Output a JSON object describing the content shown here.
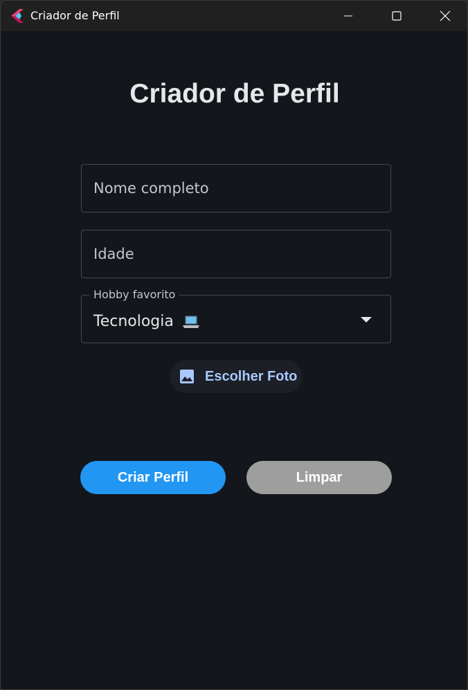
{
  "window": {
    "title": "Criador de Perfil",
    "icon": "flutter-logo-icon"
  },
  "titlebar_buttons": [
    "minimize-icon",
    "maximize-icon",
    "close-icon"
  ],
  "form": {
    "heading": "Criador de Perfil",
    "nome": {
      "placeholder": "Nome completo",
      "value": ""
    },
    "idade": {
      "placeholder": "Idade",
      "value": ""
    },
    "hobby": {
      "label": "Hobby favorito",
      "selected": "Tecnologia",
      "selected_icon": "laptop-icon"
    },
    "photo_button": {
      "label": "Escolher Foto",
      "icon": "image-icon"
    },
    "create_button": {
      "label": "Criar Perfil"
    },
    "clear_button": {
      "label": "Limpar"
    }
  },
  "colors": {
    "background": "#13161b",
    "titlebar": "#202020",
    "primary_button": "#2196f3",
    "secondary_button": "#9e9e9e",
    "photo_accent": "#a9c8ff"
  }
}
